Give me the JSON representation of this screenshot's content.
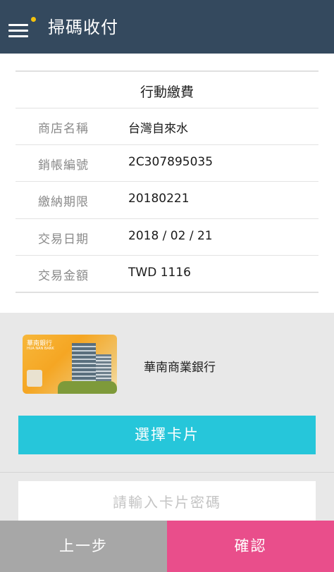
{
  "header": {
    "title": "掃碼收付",
    "menu_icon": "hamburger-menu-icon",
    "notification_color": "#f4c20d",
    "background": "#34495e"
  },
  "payment": {
    "title": "行動繳費",
    "fields": [
      {
        "label": "商店名稱",
        "value": "台灣自來水"
      },
      {
        "label": "銷帳編號",
        "value": "2C307895035"
      },
      {
        "label": "繳納期限",
        "value": "20180221"
      },
      {
        "label": "交易日期",
        "value": "2018 / 02 / 21"
      },
      {
        "label": "交易金額",
        "value": "TWD 1116"
      }
    ]
  },
  "card": {
    "bank_name": "華南商業銀行",
    "logo_text": "華南銀行",
    "logo_subtext": "HUA NAN BANK",
    "select_label": "選擇卡片",
    "select_color": "#26c6da"
  },
  "password": {
    "placeholder": "請輸入卡片密碼",
    "value": ""
  },
  "footer": {
    "prev_label": "上一步",
    "confirm_label": "確認",
    "prev_color": "#a7a7a7",
    "confirm_color": "#e94e8b"
  }
}
